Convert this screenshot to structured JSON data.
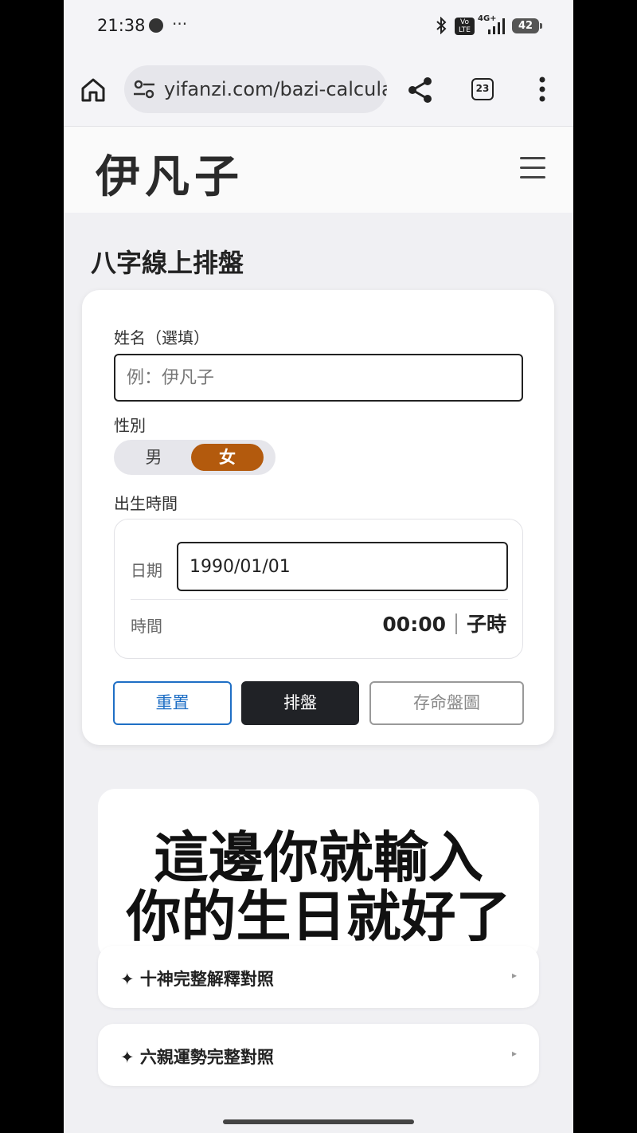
{
  "status_bar": {
    "time": "21:38",
    "more": "···",
    "network": "4G+",
    "volte": "Vo LTE",
    "battery": "42"
  },
  "browser": {
    "url": "yifanzi.com/bazi-calcula",
    "tab_count": "23"
  },
  "site": {
    "logo": "伊凡子"
  },
  "page": {
    "title": "八字線上排盤"
  },
  "form": {
    "name_label": "姓名（選填）",
    "name_placeholder": "例：伊凡子",
    "name_value": "",
    "gender_label": "性別",
    "gender_options": [
      "男",
      "女"
    ],
    "gender_selected": "女",
    "birth_label": "出生時間",
    "date_label": "日期",
    "date_value": "1990/01/01",
    "time_label": "時間",
    "time_value": "00:00",
    "time_branch": "子時",
    "reset_label": "重置",
    "calculate_label": "排盤",
    "save_label": "存命盤圖"
  },
  "overlay_caption": {
    "line1": "這邊你就輸入",
    "line2": "你的生日就好了"
  },
  "accordions": [
    {
      "title": "✦ 十神完整解釋對照",
      "arrow": "▸"
    },
    {
      "title": "✦ 六親運勢完整對照",
      "arrow": "▸"
    }
  ],
  "colors": {
    "accent_female": "#b35a0d",
    "reset_border": "#1f6fc5",
    "primary_button": "#202226"
  },
  "icons": [
    "home-icon",
    "tune-icon",
    "share-icon",
    "tabs-icon",
    "more-vert-icon",
    "hamburger-menu-icon",
    "bluetooth-icon",
    "signal-icon",
    "battery-icon"
  ]
}
